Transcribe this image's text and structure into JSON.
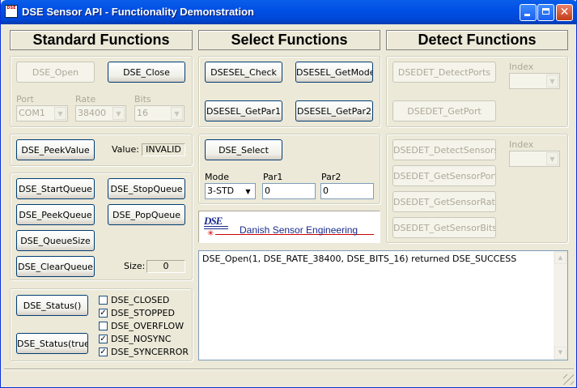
{
  "window": {
    "title": "DSE Sensor API - Functionality Demonstration",
    "icon_text": "DSE",
    "minimize_icon": "minimize-icon",
    "maximize_icon": "maximize-icon",
    "close_icon": "close-icon"
  },
  "sections": {
    "standard": "Standard Functions",
    "select": "Select Functions",
    "detect": "Detect Functions"
  },
  "standard": {
    "open_label": "DSE_Open",
    "close_label": "DSE_Close",
    "port_label": "Port",
    "port_value": "COM1",
    "rate_label": "Rate",
    "rate_value": "38400",
    "bits_label": "Bits",
    "bits_value": "16",
    "peek_value_label": "DSE_PeekValue",
    "value_label": "Value:",
    "value_readout": "INVALID",
    "start_queue_label": "DSE_StartQueue",
    "stop_queue_label": "DSE_StopQueue",
    "peek_queue_label": "DSE_PeekQueue",
    "pop_queue_label": "DSE_PopQueue",
    "queue_size_label": "DSE_QueueSize",
    "clear_queue_label": "DSE_ClearQueue",
    "size_label": "Size:",
    "size_readout": "0",
    "status_label": "DSE_Status()",
    "status_true_label": "DSE_Status(true)",
    "flags": [
      {
        "label": "DSE_CLOSED",
        "checked": false
      },
      {
        "label": "DSE_STOPPED",
        "checked": true
      },
      {
        "label": "DSE_OVERFLOW",
        "checked": false
      },
      {
        "label": "DSE_NOSYNC",
        "checked": true
      },
      {
        "label": "DSE_SYNCERROR",
        "checked": true
      }
    ]
  },
  "select": {
    "check_label": "DSESEL_Check",
    "getmode_label": "DSESEL_GetMode",
    "getpar1_label": "DSESEL_GetPar1",
    "getpar2_label": "DSESEL_GetPar2",
    "select_label": "DSE_Select",
    "mode_label": "Mode",
    "mode_value": "3-STD",
    "par1_label": "Par1",
    "par1_value": "0",
    "par2_label": "Par2",
    "par2_value": "0",
    "logo_text": "DSE",
    "company_name": "Danish Sensor Engineering",
    "brand_color": "#cc0000",
    "logo_color": "#1a2a8a"
  },
  "detect": {
    "detect_ports_label": "DSEDET_DetectPorts",
    "get_port_label": "DSEDET_GetPort",
    "index_label_1": "Index",
    "index_value_1": "",
    "detect_sensors_label": "DSEDET_DetectSensors",
    "get_sensor_port_label": "DSEDET_GetSensorPort",
    "get_sensor_rate_label": "DSEDET_GetSensorRate",
    "get_sensor_bits_label": "DSEDET_GetSensorBits",
    "index_label_2": "Index",
    "index_value_2": ""
  },
  "output": {
    "text": "DSE_Open(1, DSE_RATE_38400, DSE_BITS_16) returned DSE_SUCCESS",
    "scroll_up_icon": "scroll-up-icon",
    "scroll_down_icon": "scroll-down-icon"
  }
}
